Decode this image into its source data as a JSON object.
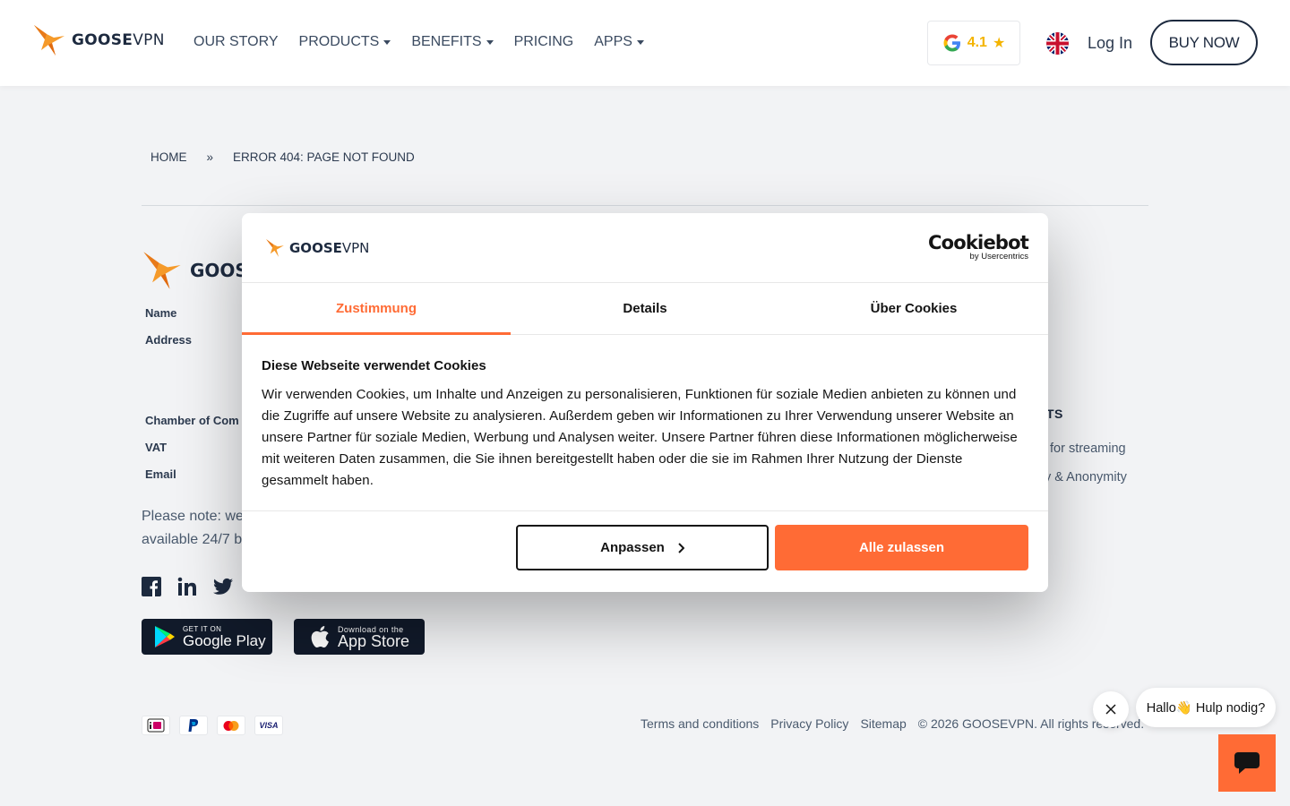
{
  "header": {
    "logo_bold": "GOOSE",
    "logo_light": "VPN",
    "nav": [
      {
        "label": "OUR STORY",
        "dropdown": false
      },
      {
        "label": "PRODUCTS",
        "dropdown": true
      },
      {
        "label": "BENEFITS",
        "dropdown": true
      },
      {
        "label": "PRICING",
        "dropdown": false
      },
      {
        "label": "APPS",
        "dropdown": true
      }
    ],
    "rating": "4.1",
    "login": "Log In",
    "buy": "BUY NOW"
  },
  "breadcrumb": {
    "home": "HOME",
    "separator": "»",
    "current": "ERROR 404: PAGE NOT FOUND"
  },
  "footer": {
    "logo_text": "GOOS",
    "info_labels": [
      "Name",
      "Address",
      "Chamber of Com",
      "VAT",
      "Email"
    ],
    "note_line1": "Please note: we",
    "note_line2": "available 24/7 b",
    "right_heading": "TS",
    "right_links": [
      "for streaming",
      "y & Anonymity",
      ":"
    ],
    "google_play_small": "GET IT ON",
    "google_play_big": "Google Play",
    "app_store_small": "Download on the",
    "app_store_big": "App Store",
    "payments": [
      "iDEAL",
      "PayPal",
      "Mastercard",
      "VISA"
    ],
    "links": [
      "Terms and conditions",
      "Privacy Policy",
      "Sitemap",
      "© 2026 GOOSEVPN. All rights reserved."
    ]
  },
  "cookie_modal": {
    "logo_bold": "GOOSE",
    "logo_light": "VPN",
    "cookiebot_main": "Cookiebot",
    "cookiebot_sub": "by Usercentrics",
    "tabs": [
      "Zustimmung",
      "Details",
      "Über Cookies"
    ],
    "title": "Diese Webseite verwendet Cookies",
    "text": "Wir verwenden Cookies, um Inhalte und Anzeigen zu personalisieren, Funktionen für soziale Medien anbieten zu können und die Zugriffe auf unsere Website zu analysieren. Außerdem geben wir Informationen zu Ihrer Verwendung unserer Website an unsere Partner für soziale Medien, Werbung und Analysen weiter. Unsere Partner führen diese Informationen möglicherweise mit weiteren Daten zusammen, die Sie ihnen bereitgestellt haben oder die sie im Rahmen Ihrer Nutzung der Dienste gesammelt haben.",
    "btn_customize": "Anpassen",
    "btn_allow": "Alle zulassen"
  },
  "chat": {
    "bubble": "Hallo👋 Hulp nodig?"
  },
  "colors": {
    "accent": "#ff6b35",
    "navy": "#1d2a3f",
    "rating": "#f4b400"
  }
}
